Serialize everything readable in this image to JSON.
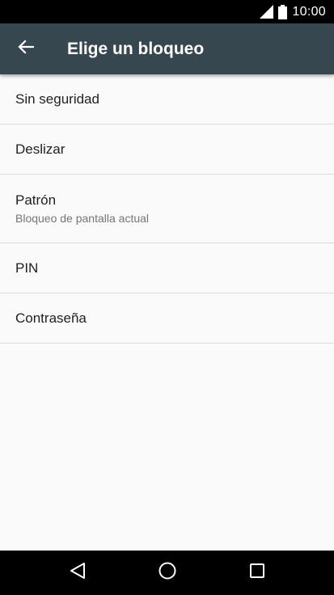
{
  "status_bar": {
    "time": "10:00",
    "icons": [
      "signal-icon",
      "battery-icon"
    ]
  },
  "app_bar": {
    "title": "Elige un bloqueo",
    "back_icon": "arrow-back-icon"
  },
  "lock_options": [
    {
      "title": "Sin seguridad",
      "subtitle": ""
    },
    {
      "title": "Deslizar",
      "subtitle": ""
    },
    {
      "title": "Patrón",
      "subtitle": "Bloqueo de pantalla actual"
    },
    {
      "title": "PIN",
      "subtitle": ""
    },
    {
      "title": "Contraseña",
      "subtitle": ""
    }
  ],
  "nav_bar": {
    "buttons": [
      "back-triangle-icon",
      "home-circle-icon",
      "recents-square-icon"
    ]
  },
  "colors": {
    "app_bar": "#37474f",
    "background": "#fafafa",
    "status_bar": "#000000",
    "nav_bar": "#000000"
  }
}
